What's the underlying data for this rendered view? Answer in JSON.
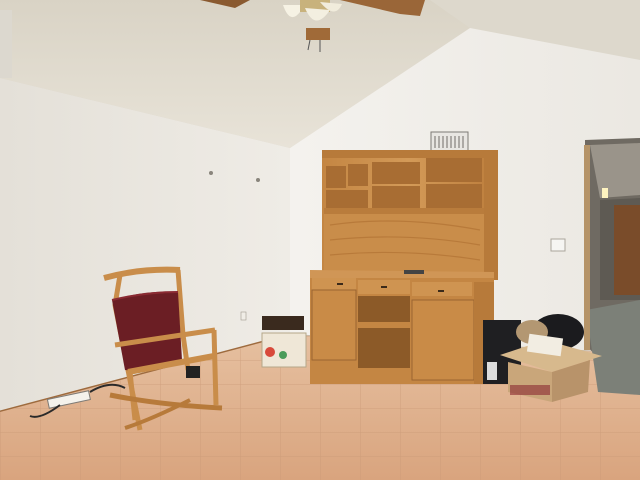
{
  "scene": {
    "subject": "room",
    "objects": [
      {
        "name": "ceiling-fan"
      },
      {
        "name": "rocking-chair"
      },
      {
        "name": "wood-hutch-desk"
      },
      {
        "name": "moving-box"
      },
      {
        "name": "pc-tower"
      },
      {
        "name": "floor-tile"
      },
      {
        "name": "hallway-doorway"
      },
      {
        "name": "hvac-vent"
      },
      {
        "name": "light-switch"
      }
    ]
  },
  "colors": {
    "ceiling": "#e7e2d6",
    "wall_left": "#ece9e3",
    "wall_right": "#f2f0ec",
    "floor": "#e0b08c",
    "wood": "#c98d4a",
    "wood_dark": "#9a6430",
    "chair_cushion": "#6b1e24",
    "box": "#c9a67a"
  }
}
